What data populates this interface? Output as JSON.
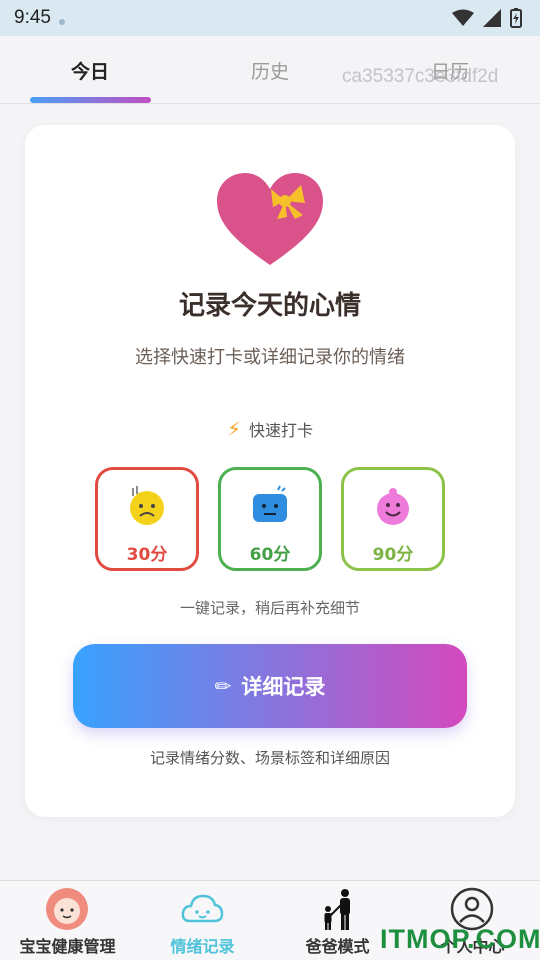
{
  "status_bar": {
    "time": "9:45"
  },
  "tabs": [
    {
      "label": "今日",
      "active": true
    },
    {
      "label": "历史",
      "active": false
    },
    {
      "label": "日历",
      "active": false
    }
  ],
  "watermark": "ca35337c3e3fdf2d",
  "card": {
    "title": "记录今天的心情",
    "subtitle": "选择快速打卡或详细记录你的情绪",
    "quick_label": "快速打卡",
    "quick_icon": "⚡",
    "moods": [
      {
        "score": "30分",
        "icon": "sad-face-icon",
        "color": "#e24b41"
      },
      {
        "score": "60分",
        "icon": "neutral-face-icon",
        "color": "#4caf50"
      },
      {
        "score": "90分",
        "icon": "happy-face-icon",
        "color": "#8bc34a"
      }
    ],
    "hint": "一键记录，稍后再补充细节",
    "detail_button": {
      "icon": "✏",
      "label": "详细记录"
    },
    "detail_desc": "记录情绪分数、场景标签和详细原因"
  },
  "bottom_nav": [
    {
      "label": "宝宝健康管理",
      "icon": "baby-avatar-icon",
      "active": false
    },
    {
      "label": "情绪记录",
      "icon": "cloud-face-icon",
      "active": true
    },
    {
      "label": "爸爸模式",
      "icon": "father-child-icon",
      "active": false
    },
    {
      "label": "个人中心",
      "icon": "person-icon",
      "active": false
    }
  ],
  "brand_overlay": "ITMOP.COM",
  "colors": {
    "accent_start": "#38a2ff",
    "accent_end": "#d449bd",
    "active_nav": "#4fc3d9"
  }
}
